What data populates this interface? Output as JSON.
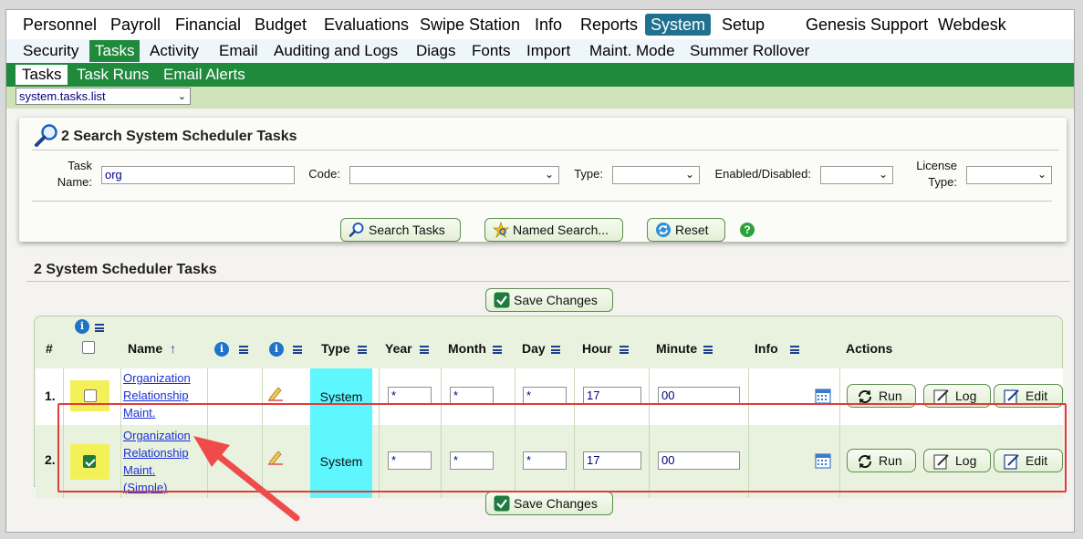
{
  "nav_primary": [
    {
      "label": "Personnel",
      "active": false
    },
    {
      "label": "Payroll",
      "active": false
    },
    {
      "label": "Financial",
      "active": false
    },
    {
      "label": "Budget",
      "active": false
    },
    {
      "label": "Evaluations",
      "active": false
    },
    {
      "label": "Swipe Station",
      "active": false
    },
    {
      "label": "Info",
      "active": false
    },
    {
      "label": "Reports",
      "active": false
    },
    {
      "label": "System",
      "active": true
    },
    {
      "label": "Setup",
      "active": false
    },
    {
      "label": "Genesis Support",
      "active": false
    },
    {
      "label": "Webdesk",
      "active": false
    }
  ],
  "nav_secondary": [
    {
      "label": "Security",
      "active": false
    },
    {
      "label": "Tasks",
      "active": true
    },
    {
      "label": "Activity",
      "active": false
    },
    {
      "label": "Email",
      "active": false
    },
    {
      "label": "Auditing and Logs",
      "active": false
    },
    {
      "label": "Diags",
      "active": false
    },
    {
      "label": "Fonts",
      "active": false
    },
    {
      "label": "Import",
      "active": false
    },
    {
      "label": "Maint. Mode",
      "active": false
    },
    {
      "label": "Summer Rollover",
      "active": false
    }
  ],
  "nav_tertiary": [
    {
      "label": "Tasks",
      "active": true
    },
    {
      "label": "Task Runs",
      "active": false
    },
    {
      "label": "Email Alerts",
      "active": false
    }
  ],
  "screen_select": {
    "value": "system.tasks.list"
  },
  "search": {
    "title": "2 Search System Scheduler Tasks",
    "task_name_label": "Task Name:",
    "task_name_value": "org",
    "code_label": "Code:",
    "type_label": "Type:",
    "enabled_label": "Enabled/Disabled:",
    "license_label": "License Type:",
    "search_button": "Search Tasks",
    "named_search_button": "Named Search...",
    "reset_button": "Reset",
    "help_glyph": "?"
  },
  "results": {
    "title": "2 System Scheduler Tasks",
    "save_button": "Save Changes",
    "headers": {
      "num": "#",
      "name": "Name",
      "sort_glyph": "↑",
      "type": "Type",
      "year": "Year",
      "month": "Month",
      "day": "Day",
      "hour": "Hour",
      "minute": "Minute",
      "info": "Info",
      "actions": "Actions"
    },
    "info_glyph": "i",
    "rows": [
      {
        "num": "1.",
        "checked": false,
        "name_lines": [
          "Organization",
          "Relationship",
          "Maint."
        ],
        "type": "System",
        "year": "*",
        "month": "*",
        "day": "*",
        "hour": "17",
        "minute": "00",
        "run": "Run",
        "log": "Log",
        "edit": "Edit"
      },
      {
        "num": "2.",
        "checked": true,
        "name_lines": [
          "Organization",
          "Relationship",
          "Maint.",
          "(Simple)"
        ],
        "type": "System",
        "year": "*",
        "month": "*",
        "day": "*",
        "hour": "17",
        "minute": "00",
        "run": "Run",
        "log": "Log",
        "edit": "Edit"
      }
    ]
  },
  "colors": {
    "system_tab": "#20718f",
    "green_bar": "#1f8a3c",
    "type_highlight": "#5ef7ff",
    "checkbox_highlight": "#f4f05a",
    "annotation": "#e23b3b"
  }
}
